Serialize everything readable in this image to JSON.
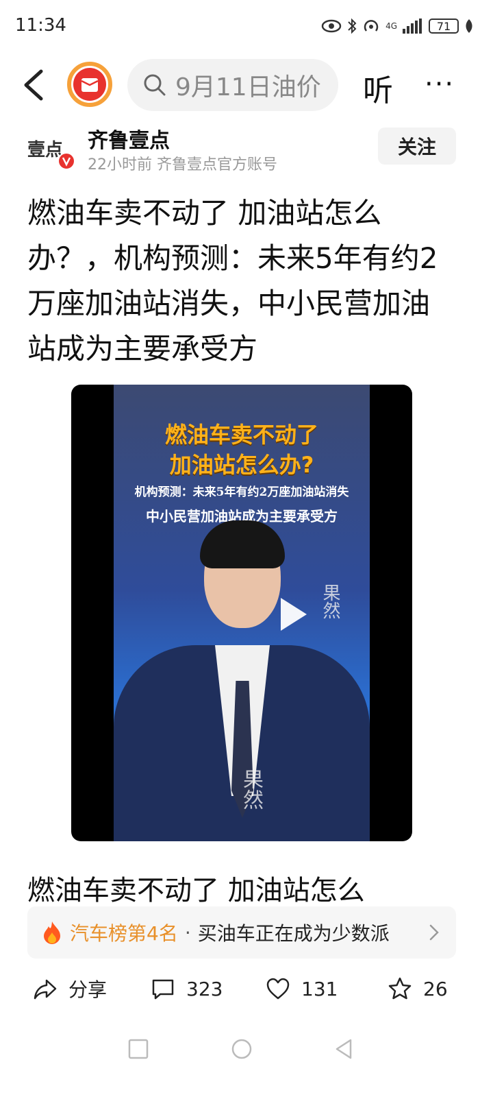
{
  "status_bar": {
    "time": "11:34",
    "battery": "71",
    "network": "4G"
  },
  "toolbar": {
    "search_text": "9月11日油价",
    "listen_label": "听",
    "more_label": "···"
  },
  "author": {
    "name": "齐鲁壹点",
    "meta": "22小时前  齐鲁壹点官方账号",
    "follow_label": "关注",
    "logo_text": "壹点"
  },
  "article": {
    "headline_lines": [
      "燃油车卖不动了 加油站怎么",
      "办？，机构预测：未来5年有约2",
      "万座加油站消失，中小民营加油",
      "站成为主要承受方"
    ],
    "summary": "燃油车卖不动了 加油站怎么"
  },
  "video": {
    "title_line1": "燃油车卖不动了",
    "title_line2": "加油站怎么办?",
    "subtitle_line1": "机构预测：未来5年有约2万座加油站消失",
    "subtitle_line2": "中小民营加油站成为主要承受方",
    "watermark": "果然"
  },
  "rank": {
    "label": "汽车榜第4名",
    "separator": "·",
    "text": "买油车正在成为少数派"
  },
  "actions": {
    "share": "分享",
    "comments": "323",
    "likes": "131",
    "favorites": "26"
  },
  "colors": {
    "accent": "#e8902a",
    "brand_red": "#e8322e",
    "logo_ring": "#f6a13a"
  }
}
